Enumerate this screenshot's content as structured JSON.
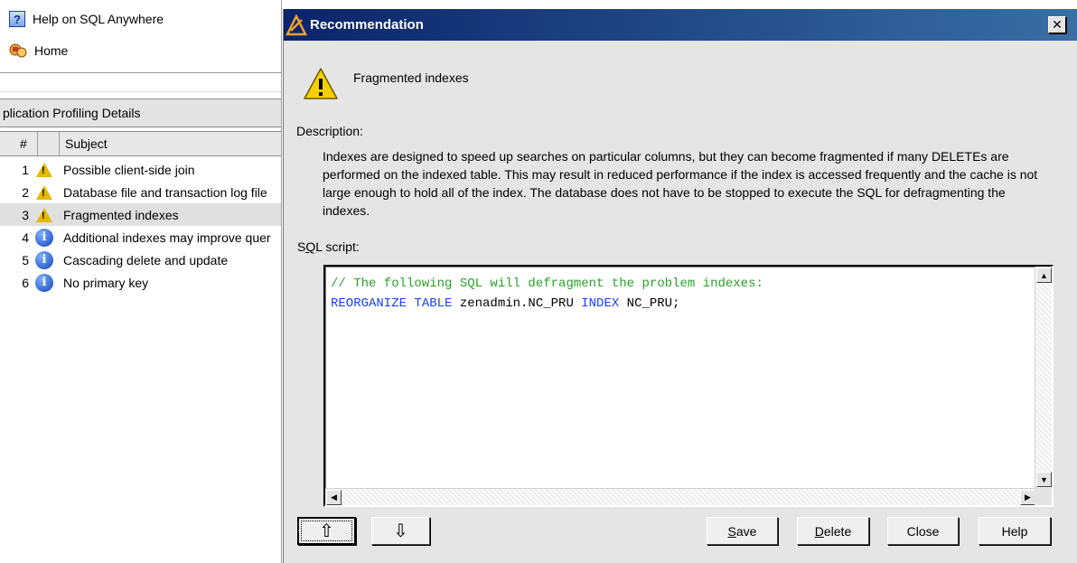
{
  "left": {
    "links": [
      {
        "label": "Help on SQL Anywhere",
        "icon": "help-icon"
      },
      {
        "label": "Home",
        "icon": "home-icon"
      }
    ],
    "section_title": "plication Profiling Details",
    "table": {
      "col_num": "#",
      "col_subject": "Subject",
      "rows": [
        {
          "num": "1",
          "icon": "warning-icon",
          "subject": "Possible client-side join",
          "selected": false
        },
        {
          "num": "2",
          "icon": "warning-icon",
          "subject": "Database file and transaction log file",
          "selected": false
        },
        {
          "num": "3",
          "icon": "warning-icon",
          "subject": "Fragmented indexes",
          "selected": true
        },
        {
          "num": "4",
          "icon": "info-icon",
          "subject": "Additional indexes may improve quer",
          "selected": false
        },
        {
          "num": "5",
          "icon": "info-icon",
          "subject": "Cascading delete and update",
          "selected": false
        },
        {
          "num": "6",
          "icon": "info-icon",
          "subject": "No primary key",
          "selected": false
        }
      ]
    }
  },
  "dialog": {
    "title": "Recommendation",
    "close_glyph": "✕",
    "recommendation": "Fragmented indexes",
    "description_label": "Description:",
    "description_text": "Indexes are designed to speed up searches on particular columns, but they can become fragmented if many DELETEs are performed on the indexed table. This may result in reduced performance if the index is accessed frequently and the cache is not large enough to hold all of the index. The database does not have to be stopped to execute the SQL for defragmenting the indexes.",
    "sql_label_prefix": "S",
    "sql_label_underlined": "Q",
    "sql_label_suffix": "L script:",
    "sql": {
      "comment": "// The following SQL will defragment the problem indexes:",
      "kw1": "REORGANIZE TABLE",
      "ident1": " zenadmin.NC_PRU ",
      "kw2": "INDEX",
      "ident2": " NC_PRU;"
    },
    "buttons": {
      "up_glyph": "⇧",
      "down_glyph": "⇩",
      "save_u": "S",
      "save_rest": "ave",
      "delete_u": "D",
      "delete_rest": "elete",
      "close": "Close",
      "help": "Help"
    }
  },
  "colors": {
    "title_start": "#0a246a",
    "title_end": "#3a6ea5",
    "warning": "#e6b800",
    "info": "#1041b8",
    "sql_comment": "#2aa12a",
    "sql_keyword": "#1a3cff"
  }
}
